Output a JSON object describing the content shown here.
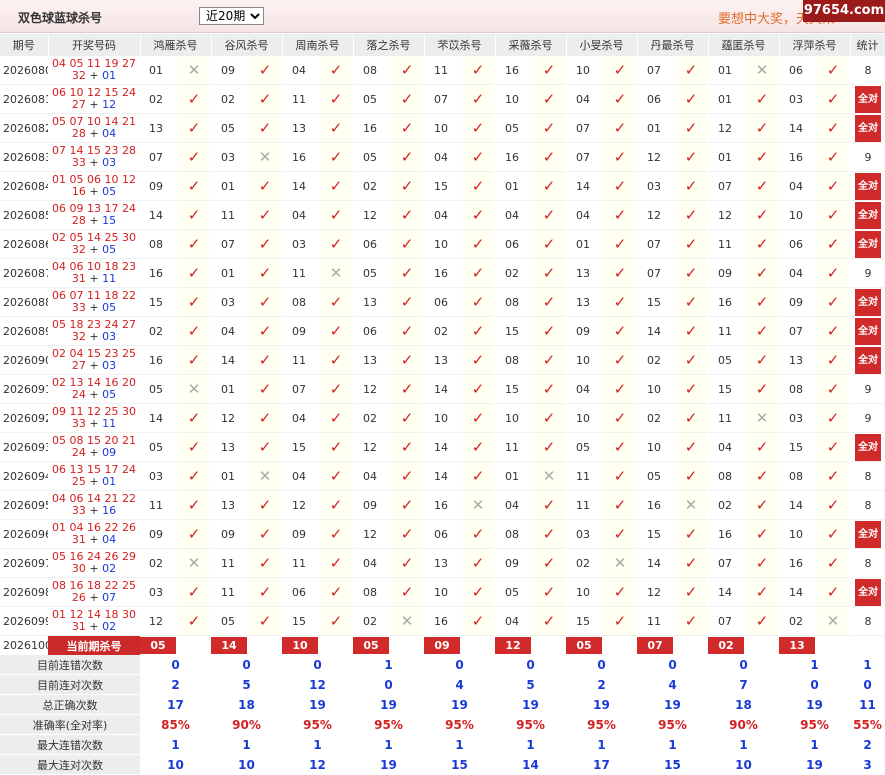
{
  "header": {
    "title": "双色球蓝球杀号",
    "period_select": "近20期",
    "slogan": "要想中大奖，天天来",
    "watermark": "97654.com"
  },
  "columns": [
    "期号",
    "开奖号码",
    "鸿雁杀号",
    "谷风杀号",
    "周南杀号",
    "落之杀号",
    "芣苡杀号",
    "采薇杀号",
    "小旻杀号",
    "丹最杀号",
    "蕴匿杀号",
    "浮萍杀号",
    "统计"
  ],
  "rows": [
    {
      "issue": "2026080",
      "reds": "04 05 11 19 27",
      "reds2": "32",
      "blue": "01",
      "kills": [
        [
          "01",
          0
        ],
        [
          "09",
          1
        ],
        [
          "04",
          1
        ],
        [
          "08",
          1
        ],
        [
          "11",
          1
        ],
        [
          "16",
          1
        ],
        [
          "10",
          1
        ],
        [
          "07",
          1
        ],
        [
          "01",
          0
        ],
        [
          "06",
          1
        ]
      ],
      "stat": "8",
      "full": false
    },
    {
      "issue": "2026081",
      "reds": "06 10 12 15 24",
      "reds2": "27",
      "blue": "12",
      "kills": [
        [
          "02",
          1
        ],
        [
          "02",
          1
        ],
        [
          "11",
          1
        ],
        [
          "05",
          1
        ],
        [
          "07",
          1
        ],
        [
          "10",
          1
        ],
        [
          "04",
          1
        ],
        [
          "06",
          1
        ],
        [
          "01",
          1
        ],
        [
          "03",
          1
        ]
      ],
      "stat": "全对",
      "full": true
    },
    {
      "issue": "2026082",
      "reds": "05 07 10 14 21",
      "reds2": "28",
      "blue": "04",
      "kills": [
        [
          "13",
          1
        ],
        [
          "05",
          1
        ],
        [
          "13",
          1
        ],
        [
          "16",
          1
        ],
        [
          "10",
          1
        ],
        [
          "05",
          1
        ],
        [
          "07",
          1
        ],
        [
          "01",
          1
        ],
        [
          "12",
          1
        ],
        [
          "14",
          1
        ]
      ],
      "stat": "全对",
      "full": true
    },
    {
      "issue": "2026083",
      "reds": "07 14 15 23 28",
      "reds2": "33",
      "blue": "03",
      "kills": [
        [
          "07",
          1
        ],
        [
          "03",
          0
        ],
        [
          "16",
          1
        ],
        [
          "05",
          1
        ],
        [
          "04",
          1
        ],
        [
          "16",
          1
        ],
        [
          "07",
          1
        ],
        [
          "12",
          1
        ],
        [
          "01",
          1
        ],
        [
          "16",
          1
        ]
      ],
      "stat": "9",
      "full": false
    },
    {
      "issue": "2026084",
      "reds": "01 05 06 10 12",
      "reds2": "16",
      "blue": "05",
      "kills": [
        [
          "09",
          1
        ],
        [
          "01",
          1
        ],
        [
          "14",
          1
        ],
        [
          "02",
          1
        ],
        [
          "15",
          1
        ],
        [
          "01",
          1
        ],
        [
          "14",
          1
        ],
        [
          "03",
          1
        ],
        [
          "07",
          1
        ],
        [
          "04",
          1
        ]
      ],
      "stat": "全对",
      "full": true
    },
    {
      "issue": "2026085",
      "reds": "06 09 13 17 24",
      "reds2": "28",
      "blue": "15",
      "kills": [
        [
          "14",
          1
        ],
        [
          "11",
          1
        ],
        [
          "04",
          1
        ],
        [
          "12",
          1
        ],
        [
          "04",
          1
        ],
        [
          "04",
          1
        ],
        [
          "04",
          1
        ],
        [
          "12",
          1
        ],
        [
          "12",
          1
        ],
        [
          "10",
          1
        ]
      ],
      "stat": "全对",
      "full": true
    },
    {
      "issue": "2026086",
      "reds": "02 05 14 25 30",
      "reds2": "32",
      "blue": "05",
      "kills": [
        [
          "08",
          1
        ],
        [
          "07",
          1
        ],
        [
          "03",
          1
        ],
        [
          "06",
          1
        ],
        [
          "10",
          1
        ],
        [
          "06",
          1
        ],
        [
          "01",
          1
        ],
        [
          "07",
          1
        ],
        [
          "11",
          1
        ],
        [
          "06",
          1
        ]
      ],
      "stat": "全对",
      "full": true
    },
    {
      "issue": "2026087",
      "reds": "04 06 10 18 23",
      "reds2": "31",
      "blue": "11",
      "kills": [
        [
          "16",
          1
        ],
        [
          "01",
          1
        ],
        [
          "11",
          0
        ],
        [
          "05",
          1
        ],
        [
          "16",
          1
        ],
        [
          "02",
          1
        ],
        [
          "13",
          1
        ],
        [
          "07",
          1
        ],
        [
          "09",
          1
        ],
        [
          "04",
          1
        ]
      ],
      "stat": "9",
      "full": false
    },
    {
      "issue": "2026088",
      "reds": "06 07 11 18 22",
      "reds2": "33",
      "blue": "05",
      "kills": [
        [
          "15",
          1
        ],
        [
          "03",
          1
        ],
        [
          "08",
          1
        ],
        [
          "13",
          1
        ],
        [
          "06",
          1
        ],
        [
          "08",
          1
        ],
        [
          "13",
          1
        ],
        [
          "15",
          1
        ],
        [
          "16",
          1
        ],
        [
          "09",
          1
        ]
      ],
      "stat": "全对",
      "full": true
    },
    {
      "issue": "2026089",
      "reds": "05 18 23 24 27",
      "reds2": "32",
      "blue": "03",
      "kills": [
        [
          "02",
          1
        ],
        [
          "04",
          1
        ],
        [
          "09",
          1
        ],
        [
          "06",
          1
        ],
        [
          "02",
          1
        ],
        [
          "15",
          1
        ],
        [
          "09",
          1
        ],
        [
          "14",
          1
        ],
        [
          "11",
          1
        ],
        [
          "07",
          1
        ]
      ],
      "stat": "全对",
      "full": true
    },
    {
      "issue": "2026090",
      "reds": "02 04 15 23 25",
      "reds2": "27",
      "blue": "03",
      "kills": [
        [
          "16",
          1
        ],
        [
          "14",
          1
        ],
        [
          "11",
          1
        ],
        [
          "13",
          1
        ],
        [
          "13",
          1
        ],
        [
          "08",
          1
        ],
        [
          "10",
          1
        ],
        [
          "02",
          1
        ],
        [
          "05",
          1
        ],
        [
          "13",
          1
        ]
      ],
      "stat": "全对",
      "full": true
    },
    {
      "issue": "2026091",
      "reds": "02 13 14 16 20",
      "reds2": "24",
      "blue": "05",
      "kills": [
        [
          "05",
          0
        ],
        [
          "01",
          1
        ],
        [
          "07",
          1
        ],
        [
          "12",
          1
        ],
        [
          "14",
          1
        ],
        [
          "15",
          1
        ],
        [
          "04",
          1
        ],
        [
          "10",
          1
        ],
        [
          "15",
          1
        ],
        [
          "08",
          1
        ]
      ],
      "stat": "9",
      "full": false
    },
    {
      "issue": "2026092",
      "reds": "09 11 12 25 30",
      "reds2": "33",
      "blue": "11",
      "kills": [
        [
          "14",
          1
        ],
        [
          "12",
          1
        ],
        [
          "04",
          1
        ],
        [
          "02",
          1
        ],
        [
          "10",
          1
        ],
        [
          "10",
          1
        ],
        [
          "10",
          1
        ],
        [
          "02",
          1
        ],
        [
          "11",
          0
        ],
        [
          "03",
          1
        ]
      ],
      "stat": "9",
      "full": false
    },
    {
      "issue": "2026093",
      "reds": "05 08 15 20 21",
      "reds2": "24",
      "blue": "09",
      "kills": [
        [
          "05",
          1
        ],
        [
          "13",
          1
        ],
        [
          "15",
          1
        ],
        [
          "12",
          1
        ],
        [
          "14",
          1
        ],
        [
          "11",
          1
        ],
        [
          "05",
          1
        ],
        [
          "10",
          1
        ],
        [
          "04",
          1
        ],
        [
          "15",
          1
        ]
      ],
      "stat": "全对",
      "full": true
    },
    {
      "issue": "2026094",
      "reds": "06 13 15 17 24",
      "reds2": "25",
      "blue": "01",
      "kills": [
        [
          "03",
          1
        ],
        [
          "01",
          0
        ],
        [
          "04",
          1
        ],
        [
          "04",
          1
        ],
        [
          "14",
          1
        ],
        [
          "01",
          0
        ],
        [
          "11",
          1
        ],
        [
          "05",
          1
        ],
        [
          "08",
          1
        ],
        [
          "08",
          1
        ]
      ],
      "stat": "8",
      "full": false
    },
    {
      "issue": "2026095",
      "reds": "04 06 14 21 22",
      "reds2": "33",
      "blue": "16",
      "kills": [
        [
          "11",
          1
        ],
        [
          "13",
          1
        ],
        [
          "12",
          1
        ],
        [
          "09",
          1
        ],
        [
          "16",
          0
        ],
        [
          "04",
          1
        ],
        [
          "11",
          1
        ],
        [
          "16",
          0
        ],
        [
          "02",
          1
        ],
        [
          "14",
          1
        ]
      ],
      "stat": "8",
      "full": false
    },
    {
      "issue": "2026096",
      "reds": "01 04 16 22 26",
      "reds2": "31",
      "blue": "04",
      "kills": [
        [
          "09",
          1
        ],
        [
          "09",
          1
        ],
        [
          "09",
          1
        ],
        [
          "12",
          1
        ],
        [
          "06",
          1
        ],
        [
          "08",
          1
        ],
        [
          "03",
          1
        ],
        [
          "15",
          1
        ],
        [
          "16",
          1
        ],
        [
          "10",
          1
        ]
      ],
      "stat": "全对",
      "full": true
    },
    {
      "issue": "2026097",
      "reds": "05 16 24 26 29",
      "reds2": "30",
      "blue": "02",
      "kills": [
        [
          "02",
          0
        ],
        [
          "11",
          1
        ],
        [
          "11",
          1
        ],
        [
          "04",
          1
        ],
        [
          "13",
          1
        ],
        [
          "09",
          1
        ],
        [
          "02",
          0
        ],
        [
          "14",
          1
        ],
        [
          "07",
          1
        ],
        [
          "16",
          1
        ]
      ],
      "stat": "8",
      "full": false
    },
    {
      "issue": "2026098",
      "reds": "08 16 18 22 25",
      "reds2": "26",
      "blue": "07",
      "kills": [
        [
          "03",
          1
        ],
        [
          "11",
          1
        ],
        [
          "06",
          1
        ],
        [
          "08",
          1
        ],
        [
          "10",
          1
        ],
        [
          "05",
          1
        ],
        [
          "10",
          1
        ],
        [
          "12",
          1
        ],
        [
          "14",
          1
        ],
        [
          "14",
          1
        ]
      ],
      "stat": "全对",
      "full": true
    },
    {
      "issue": "2026099",
      "reds": "01 12 14 18 30",
      "reds2": "31",
      "blue": "02",
      "kills": [
        [
          "12",
          1
        ],
        [
          "05",
          1
        ],
        [
          "15",
          1
        ],
        [
          "02",
          0
        ],
        [
          "16",
          1
        ],
        [
          "04",
          1
        ],
        [
          "15",
          1
        ],
        [
          "11",
          1
        ],
        [
          "07",
          1
        ],
        [
          "02",
          0
        ]
      ],
      "stat": "8",
      "full": false
    }
  ],
  "current": {
    "issue": "2026100",
    "label": "当前期杀号",
    "kills": [
      "05",
      "14",
      "10",
      "05",
      "09",
      "12",
      "05",
      "07",
      "02",
      "13"
    ]
  },
  "stats": [
    {
      "label": "目前连错次数",
      "values": [
        "0",
        "0",
        "0",
        "1",
        "0",
        "0",
        "0",
        "0",
        "0",
        "1",
        "1"
      ],
      "red": false
    },
    {
      "label": "目前连对次数",
      "values": [
        "2",
        "5",
        "12",
        "0",
        "4",
        "5",
        "2",
        "4",
        "7",
        "0",
        "0"
      ],
      "red": false
    },
    {
      "label": "总正确次数",
      "values": [
        "17",
        "18",
        "19",
        "19",
        "19",
        "19",
        "19",
        "19",
        "18",
        "19",
        "11"
      ],
      "red": false
    },
    {
      "label": "准确率(全对率)",
      "values": [
        "85%",
        "90%",
        "95%",
        "95%",
        "95%",
        "95%",
        "95%",
        "95%",
        "90%",
        "95%",
        "55%"
      ],
      "red": true
    },
    {
      "label": "最大连错次数",
      "values": [
        "1",
        "1",
        "1",
        "1",
        "1",
        "1",
        "1",
        "1",
        "1",
        "1",
        "2"
      ],
      "red": false
    },
    {
      "label": "最大连对次数",
      "values": [
        "10",
        "10",
        "12",
        "19",
        "15",
        "14",
        "17",
        "15",
        "10",
        "19",
        "3"
      ],
      "red": false
    }
  ]
}
